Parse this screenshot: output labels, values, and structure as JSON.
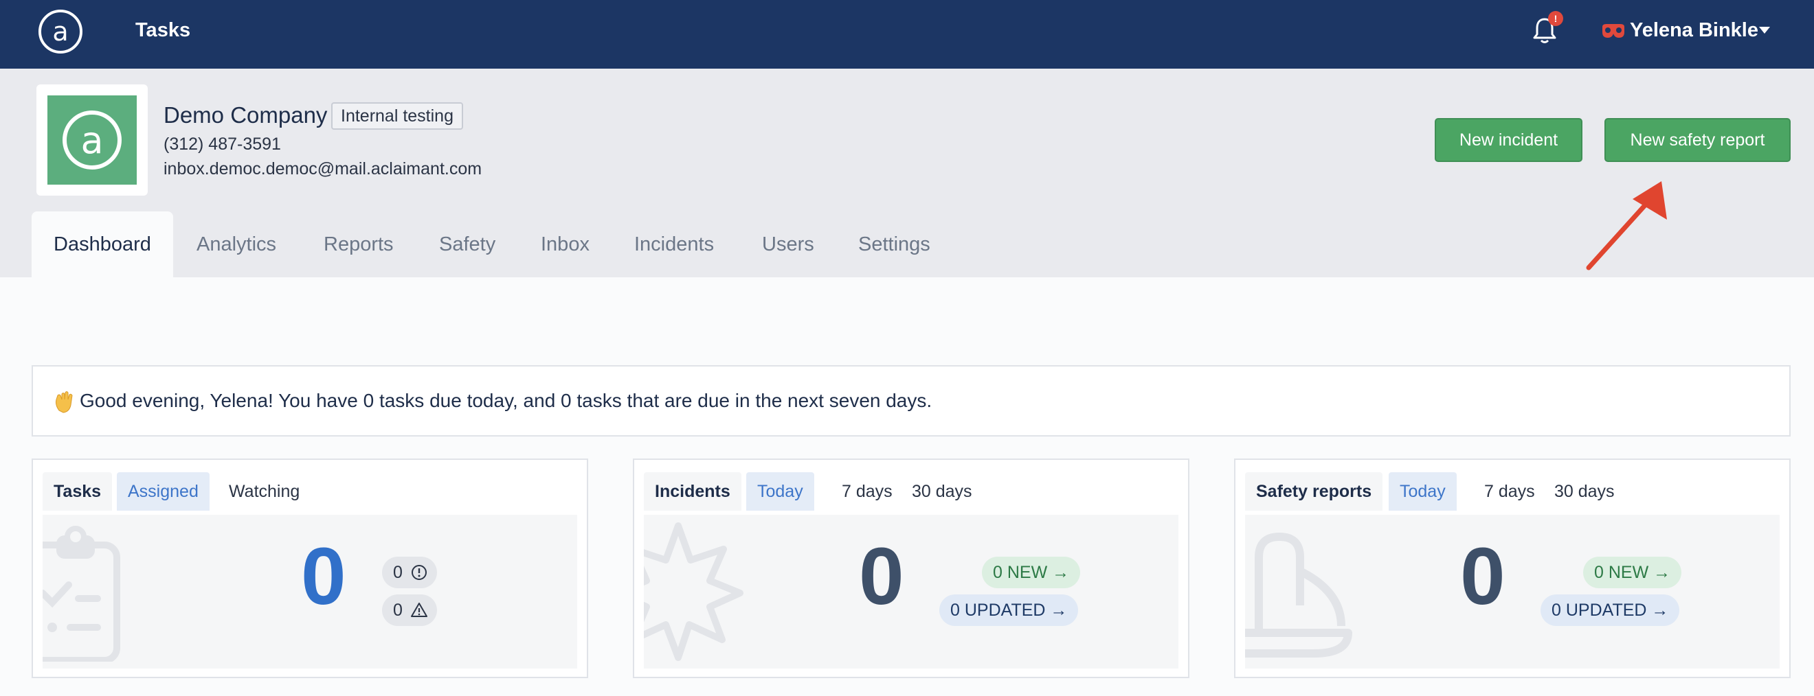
{
  "nav": {
    "title": "Tasks",
    "notification_count": "!",
    "user_name": "Yelena Binkle"
  },
  "company": {
    "name": "Demo Company",
    "badge": "Internal testing",
    "phone": "(312) 487-3591",
    "email": "inbox.democ.democ@mail.aclaimant.com"
  },
  "actions": {
    "new_incident": "New incident",
    "new_safety_report": "New safety report"
  },
  "tabs": [
    "Dashboard",
    "Analytics",
    "Reports",
    "Safety",
    "Inbox",
    "Incidents",
    "Users",
    "Settings"
  ],
  "greeting": "Good evening, Yelena! You have 0 tasks due today, and 0 tasks that are due in the next seven days.",
  "cards": {
    "tasks": {
      "label": "Tasks",
      "tabs": [
        "Assigned",
        "Watching"
      ],
      "count": "0",
      "overdue": "0",
      "warning": "0"
    },
    "incidents": {
      "label": "Incidents",
      "tabs": [
        "Today",
        "7 days",
        "30 days"
      ],
      "count": "0",
      "new": "0 NEW",
      "updated": "0 UPDATED"
    },
    "safety": {
      "label": "Safety reports",
      "tabs": [
        "Today",
        "7 days",
        "30 days"
      ],
      "count": "0",
      "new": "0 NEW",
      "updated": "0 UPDATED"
    }
  },
  "colors": {
    "nav_bg": "#1c3664",
    "accent_green": "#4ba563",
    "accent_blue": "#3d75c9",
    "arrow_red": "#e0452f"
  }
}
